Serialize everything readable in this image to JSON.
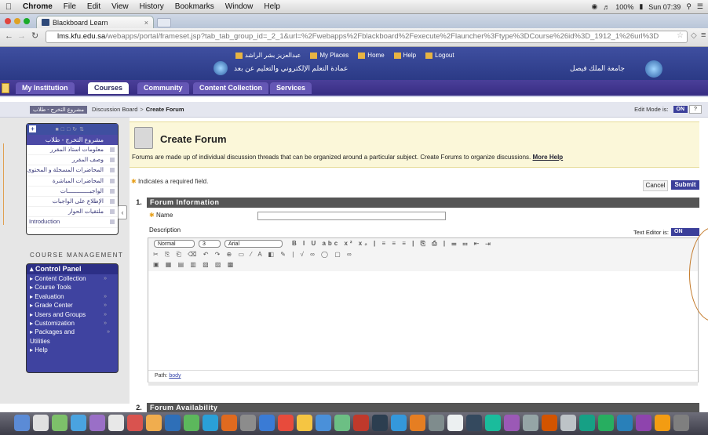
{
  "menubar": {
    "app": "Chrome",
    "items": [
      "File",
      "Edit",
      "View",
      "History",
      "Bookmarks",
      "Window",
      "Help"
    ],
    "battery": "100%",
    "clock": "Sun 07:39"
  },
  "browser": {
    "tab_title": "Blackboard Learn",
    "url_host": "lms.kfu.edu.sa",
    "url_path": "/webapps/portal/frameset.jsp?tab_tab_group_id=_2_1&url=%2Fwebapps%2Fblackboard%2Fexecute%2Flauncher%3Ftype%3DCourse%26id%3D_1912_1%26url%3D"
  },
  "header": {
    "user_arabic": "عبدالعزيز بشر الراشد",
    "links": [
      "My Places",
      "Home",
      "Help",
      "Logout"
    ],
    "title_center": "عمادة التعلم الإلكتروني والتعليم عن بعد",
    "title_right": "جامعة الملك فيصل"
  },
  "nav_tabs": [
    "My Institution",
    "Courses",
    "Community",
    "Content Collection",
    "Services"
  ],
  "breadcrumb": {
    "course": "مشروع التخرج - طلاب",
    "items": [
      "Discussion Board",
      "Create Forum"
    ],
    "edit_mode_label": "Edit Mode is:",
    "edit_mode_value": "ON"
  },
  "course_menu": {
    "title": "مشروع التخرج - طلاب",
    "items": [
      "معلومات استاذ المقرر",
      "وصف المقرر",
      "المحاضرات المسجلة و المحتوى",
      "المحاضرات المباشرة",
      "الواجبـــــــــــــات",
      "الإطلاع على الواجبات",
      "ملتقيات الحوار",
      "Introduction"
    ]
  },
  "course_management": {
    "heading": "COURSE MANAGEMENT",
    "panel_title": "Control Panel",
    "items": [
      "Content Collection",
      "Course Tools",
      "Evaluation",
      "Grade Center",
      "Users and Groups",
      "Customization",
      "Packages and Utilities",
      "Help"
    ]
  },
  "page": {
    "title": "Create Forum",
    "intro": "Forums are made up of individual discussion threads that can be organized around a particular subject. Create Forums to organize discussions.",
    "more_help": "More Help",
    "required_note": "Indicates a required field.",
    "cancel": "Cancel",
    "submit": "Submit",
    "section1_num": "1.",
    "section1_label": "Forum Information",
    "name_label": "Name",
    "description_label": "Description",
    "text_editor_label": "Text Editor is:",
    "text_editor_value": "ON",
    "format_select": "Normal",
    "size_select": "3",
    "font_select": "Arial",
    "path_label": "Path:",
    "path_value": "body",
    "section2_num": "2.",
    "section2_label": "Forum Availability"
  }
}
